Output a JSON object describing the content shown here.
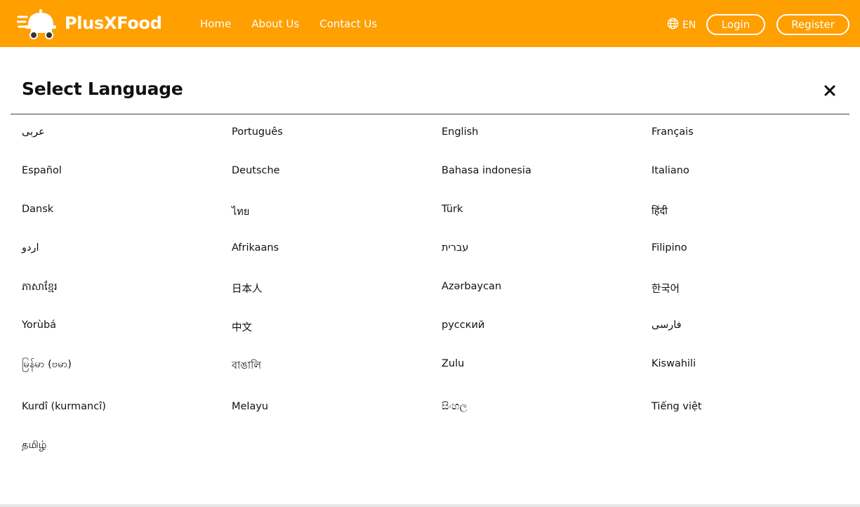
{
  "brand": {
    "name_part1": "PlusX",
    "name_part2": "Food",
    "icon": "food-delivery-cart-icon"
  },
  "nav": {
    "items": [
      "Home",
      "About Us",
      "Contact Us"
    ]
  },
  "header": {
    "language_code": "EN",
    "globe_icon": "globe-icon",
    "login_label": "Login",
    "register_label": "Register"
  },
  "colors": {
    "brand": "#FF9F00",
    "text": "#111111"
  },
  "modal": {
    "title": "Select Language",
    "close_icon": "close-icon"
  },
  "languages": [
    "عربى",
    "Português",
    "English",
    "Français",
    "Español",
    "Deutsche",
    "Bahasa indonesia",
    "Italiano",
    "Dansk",
    "ไทย",
    "Türk",
    "हिंदी",
    "اردو",
    "Afrikaans",
    "עברית",
    "Filipino",
    "ភាសាខ្មែរ",
    "日本人",
    "Azərbaycan",
    "한국어",
    "Yorùbá",
    "中文",
    "русский",
    "فارسی",
    "မြန်မာ (ဗမာ)",
    "বাঙালি",
    "Zulu",
    "Kiswahili",
    "Kurdî (kurmancî)",
    "Melayu",
    "සිංහල",
    "Tiếng việt",
    "தமிழ்"
  ]
}
